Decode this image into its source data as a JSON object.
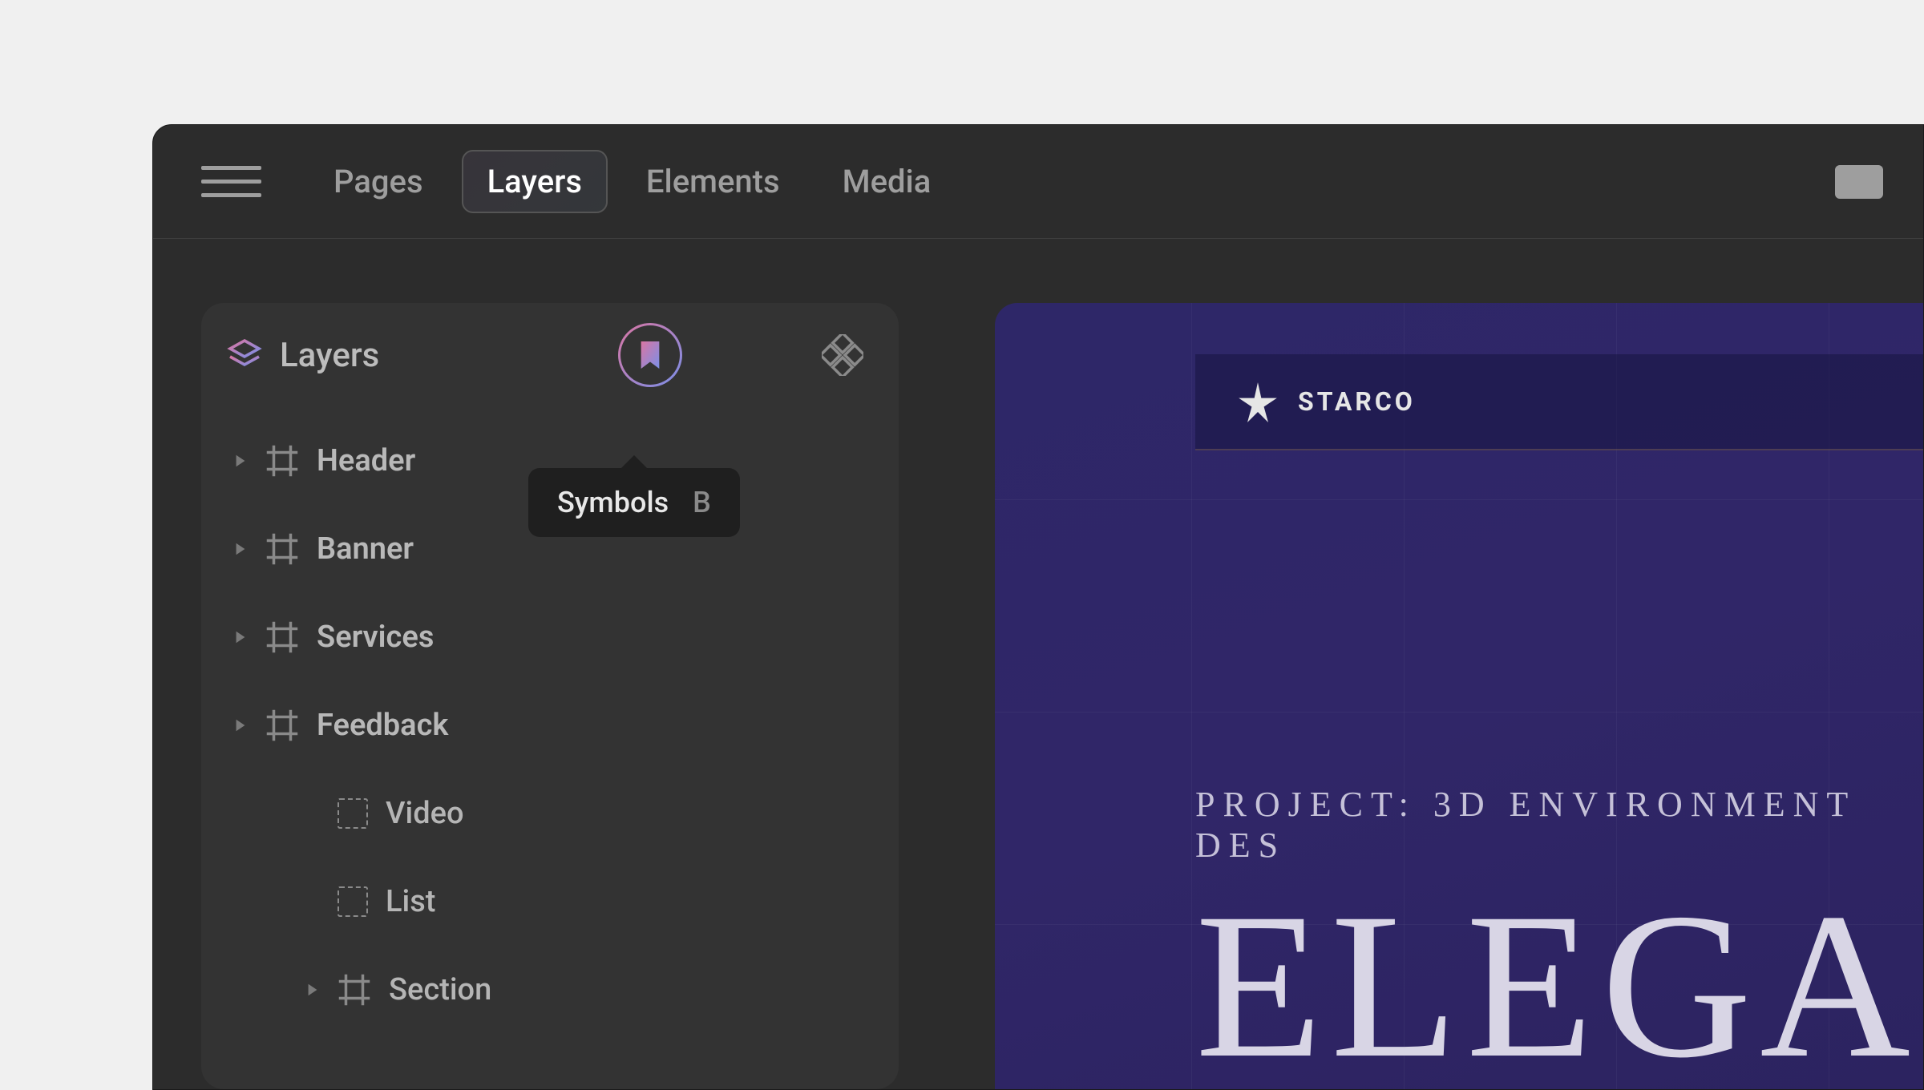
{
  "topbar": {
    "tabs": [
      "Pages",
      "Layers",
      "Elements",
      "Media"
    ],
    "active_index": 1
  },
  "panel": {
    "title": "Layers",
    "tooltip": {
      "label": "Symbols",
      "shortcut": "B"
    },
    "layers": [
      {
        "label": "Header",
        "type": "frame",
        "expandable": true,
        "depth": 0
      },
      {
        "label": "Banner",
        "type": "frame",
        "expandable": true,
        "depth": 0
      },
      {
        "label": "Services",
        "type": "frame",
        "expandable": true,
        "depth": 0
      },
      {
        "label": "Feedback",
        "type": "frame",
        "expandable": true,
        "depth": 0
      },
      {
        "label": "Video",
        "type": "element",
        "expandable": false,
        "depth": 1
      },
      {
        "label": "List",
        "type": "element",
        "expandable": false,
        "depth": 1
      },
      {
        "label": "Section",
        "type": "frame",
        "expandable": true,
        "depth": 1
      }
    ]
  },
  "canvas": {
    "brand": "STARCO",
    "project_label": "PROJECT: 3D ENVIRONMENT DES",
    "hero_title": "ELEGA"
  }
}
